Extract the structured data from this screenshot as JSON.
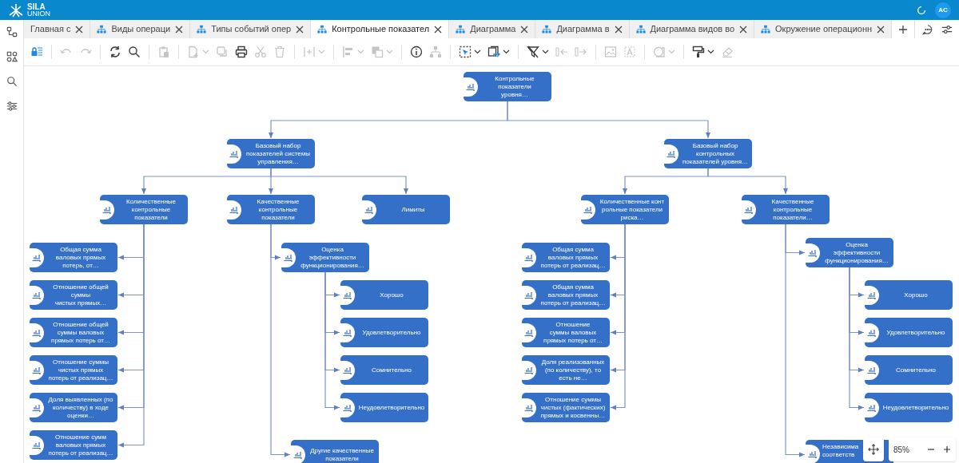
{
  "header": {
    "brand_line1": "SILA",
    "brand_line2": "UNION",
    "avatar": "AC"
  },
  "tabs": [
    {
      "label": "Главная с",
      "selected": false,
      "has_icon": false
    },
    {
      "label": "Виды операци",
      "selected": false,
      "has_icon": true
    },
    {
      "label": "Типы событий опер",
      "selected": false,
      "has_icon": true
    },
    {
      "label": "Контрольные показател",
      "selected": true,
      "has_icon": true
    },
    {
      "label": "Диаграмма",
      "selected": false,
      "has_icon": true
    },
    {
      "label": "Диаграмма в",
      "selected": false,
      "has_icon": true
    },
    {
      "label": "Диаграмма видов во",
      "selected": false,
      "has_icon": true
    },
    {
      "label": "Окружение операционн",
      "selected": false,
      "has_icon": true
    }
  ],
  "toolbar": [
    {
      "kind": "lock",
      "disabled": false,
      "dropdown": false
    },
    {
      "kind": "separator"
    },
    {
      "kind": "undo",
      "disabled": true,
      "dropdown": false
    },
    {
      "kind": "redo",
      "disabled": true,
      "dropdown": false
    },
    {
      "kind": "separator"
    },
    {
      "kind": "refresh",
      "disabled": false,
      "dropdown": false
    },
    {
      "kind": "search",
      "disabled": false,
      "dropdown": false
    },
    {
      "kind": "separator"
    },
    {
      "kind": "paste",
      "disabled": true,
      "dropdown": false
    },
    {
      "kind": "separator"
    },
    {
      "kind": "new-page",
      "disabled": true,
      "dropdown": true
    },
    {
      "kind": "copy",
      "disabled": true,
      "dropdown": false
    },
    {
      "kind": "print",
      "disabled": false,
      "dropdown": false
    },
    {
      "kind": "cut",
      "disabled": true,
      "dropdown": false
    },
    {
      "kind": "delete",
      "disabled": true,
      "dropdown": false
    },
    {
      "kind": "separator"
    },
    {
      "kind": "insert",
      "disabled": true,
      "dropdown": true
    },
    {
      "kind": "separator"
    },
    {
      "kind": "align",
      "disabled": true,
      "dropdown": true
    },
    {
      "kind": "arrange",
      "disabled": true,
      "dropdown": true
    },
    {
      "kind": "separator"
    },
    {
      "kind": "info",
      "disabled": false,
      "dropdown": false
    },
    {
      "kind": "tree",
      "disabled": true,
      "dropdown": false
    },
    {
      "kind": "separator"
    },
    {
      "kind": "select",
      "disabled": false,
      "dropdown": true
    },
    {
      "kind": "export",
      "disabled": false,
      "dropdown": true
    },
    {
      "kind": "separator"
    },
    {
      "kind": "filter",
      "disabled": false,
      "dropdown": true
    },
    {
      "kind": "collapse",
      "disabled": true,
      "dropdown": false
    },
    {
      "kind": "expand",
      "disabled": true,
      "dropdown": false
    },
    {
      "kind": "separator"
    },
    {
      "kind": "image",
      "disabled": true,
      "dropdown": false
    },
    {
      "kind": "text-frame",
      "disabled": true,
      "dropdown": false
    },
    {
      "kind": "separator"
    },
    {
      "kind": "shape",
      "disabled": true,
      "dropdown": true
    },
    {
      "kind": "separator"
    },
    {
      "kind": "paint",
      "disabled": false,
      "dropdown": true
    },
    {
      "kind": "eraser",
      "disabled": true,
      "dropdown": false
    }
  ],
  "diagram": {
    "root": {
      "label": "Контрольные\nпоказатели\nуровня…",
      "children": [
        {
          "label": "Базовый набор\nпоказателей системы\nуправления…",
          "children": [
            {
              "label": "Количественные\nконтрольные\nпоказатели",
              "children": [
                {
                  "label": "Общая сумма\nваловых прямых\nпотерь, от…"
                },
                {
                  "label": "Отношение общей\nсуммы\nчистых прямых…"
                },
                {
                  "label": "Отношение общей\nсуммы валовых\nпрямых потерь от…"
                },
                {
                  "label": "Отношение суммы\nчистых прямых\nпотерь от реализац…"
                },
                {
                  "label": "Доля выявленных (по\nколичеству) в ходе\nоценки…"
                },
                {
                  "label": "Отношение сумм\nваловых прямых\nпотерь от реализац…"
                }
              ]
            },
            {
              "label": "Качественные\nконтрольные\nпоказатели",
              "children": [
                {
                  "label": "Оценка\nэффективности\nфункционирования…",
                  "children": [
                    {
                      "label": "Хорошо"
                    },
                    {
                      "label": "Удовлетворительно"
                    },
                    {
                      "label": "Сомнительно"
                    },
                    {
                      "label": "Неудовлетворительно"
                    }
                  ]
                },
                {
                  "label": "Другие качественные\nпоказатели"
                }
              ]
            },
            {
              "label": "Лимиты"
            }
          ]
        },
        {
          "label": "Базовый набор\nконтрольных\nпоказателей уровня…",
          "children": [
            {
              "label": "Количественные конт\nрольные показатели\nриска…",
              "children": [
                {
                  "label": "Общая сумма\nваловых прямых\nпотерь от реализац…"
                },
                {
                  "label": "Общая сумма\nваловых прямых\nпотерь от реализац…"
                },
                {
                  "label": "Отношение\nсуммы валовых\nпрямых потерь от…"
                },
                {
                  "label": "Доля реализованных\n(по количеству), то\nесть не…"
                },
                {
                  "label": "Отношение суммы\nчистых (фактических)\nпрямых и косвенны…"
                }
              ]
            },
            {
              "label": "Качественные\nконтрольные\nпоказатели…",
              "children": [
                {
                  "label": "Оценка\nэффективности\nфункционирования…",
                  "children": [
                    {
                      "label": "Хорошо"
                    },
                    {
                      "label": "Удовлетворительно"
                    },
                    {
                      "label": "Сомнительно"
                    },
                    {
                      "label": "Неудовлетворительно"
                    }
                  ]
                },
                {
                  "label": "Независима\nсоответств"
                }
              ]
            }
          ]
        }
      ]
    }
  },
  "zoom": {
    "value": "85%"
  }
}
